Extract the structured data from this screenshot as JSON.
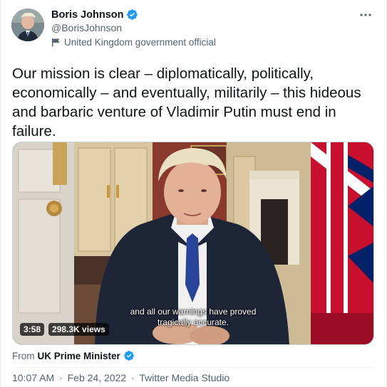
{
  "author": {
    "name": "Boris Johnson",
    "handle": "@BorisJohnson",
    "label": "United Kingdom government official"
  },
  "tweet": {
    "text": "Our mission is clear – diplomatically, politically, economically – and eventually, militarily – this hideous and barbaric venture of Vladimir Putin must end in failure."
  },
  "video": {
    "caption_line1": "and all our warnings have proved",
    "caption_line2": "tragically accurate.",
    "duration": "3:58",
    "views": "298.3K views"
  },
  "source": {
    "prefix": "From",
    "name": "UK Prime Minister"
  },
  "meta": {
    "time": "10:07 AM",
    "date": "Feb 24, 2022",
    "client": "Twitter Media Studio",
    "separator": "·"
  },
  "colors": {
    "verified_blue": "#1d9bf0",
    "secondary_text": "#536471",
    "primary_text": "#0f1419"
  }
}
